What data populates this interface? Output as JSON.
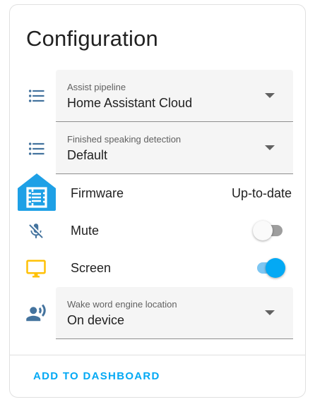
{
  "card": {
    "title": "Configuration"
  },
  "assist_pipeline": {
    "label": "Assist pipeline",
    "value": "Home Assistant Cloud",
    "icon": "format-list-bulleted-icon"
  },
  "finished_speaking": {
    "label": "Finished speaking detection",
    "value": "Default",
    "icon": "format-list-bulleted-icon"
  },
  "firmware": {
    "label": "Firmware",
    "state": "Up-to-date",
    "icon": "esphome-logo-icon"
  },
  "mute": {
    "label": "Mute",
    "on": false,
    "icon": "microphone-off-icon"
  },
  "screen": {
    "label": "Screen",
    "on": true,
    "icon": "monitor-icon"
  },
  "wake_word": {
    "label": "Wake word engine location",
    "value": "On device",
    "icon": "account-voice-icon"
  },
  "actions": {
    "add_to_dashboard": "ADD TO DASHBOARD"
  },
  "colors": {
    "accent": "#03a9f4",
    "icon": "#44739e",
    "screen_icon": "#ffc107",
    "esphome": "#1ea0e6"
  }
}
